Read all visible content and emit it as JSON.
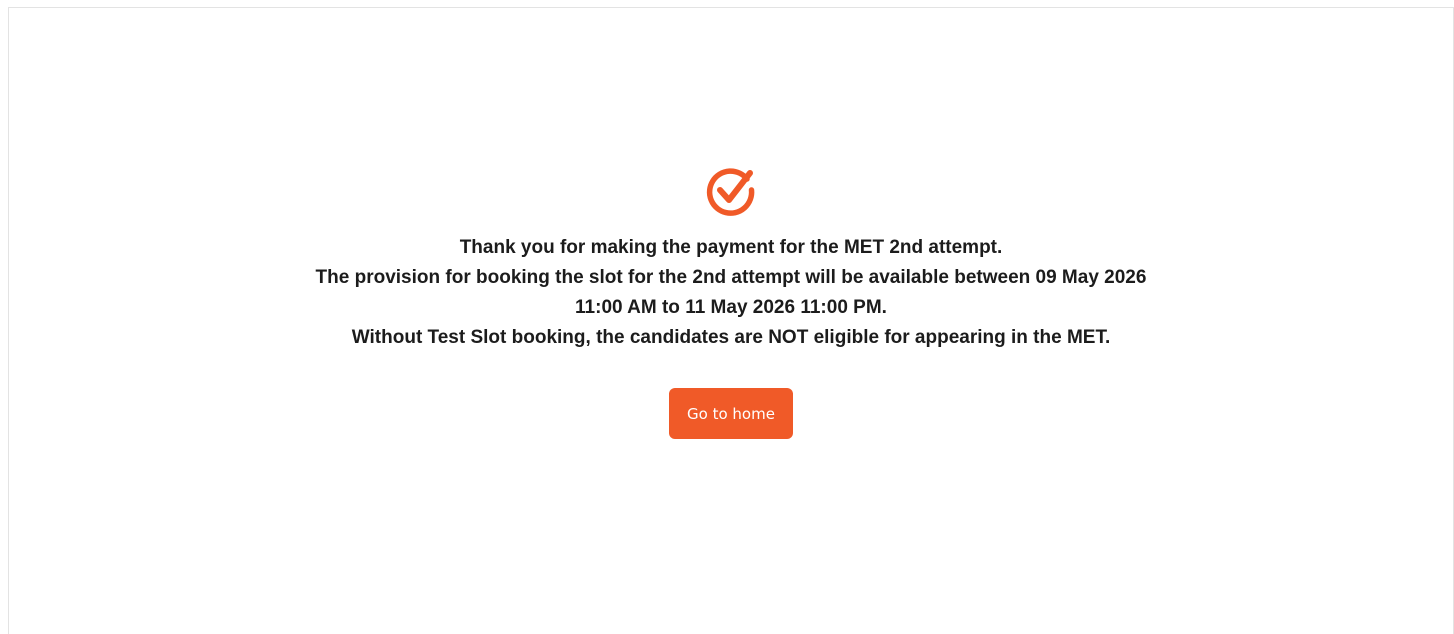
{
  "success": {
    "icon": "check-circle-icon",
    "accent_color": "#f05a28"
  },
  "message": {
    "line1": "Thank you for making the payment for the MET 2nd attempt.",
    "line2": "The provision for booking the slot for the 2nd attempt will be available between 09 May 2026 11:00 AM to 11 May 2026 11:00 PM.",
    "line3": "Without Test Slot booking, the candidates are NOT eligible for appearing in the MET."
  },
  "actions": {
    "home_label": "Go to home",
    "button_color": "#f05a28"
  }
}
